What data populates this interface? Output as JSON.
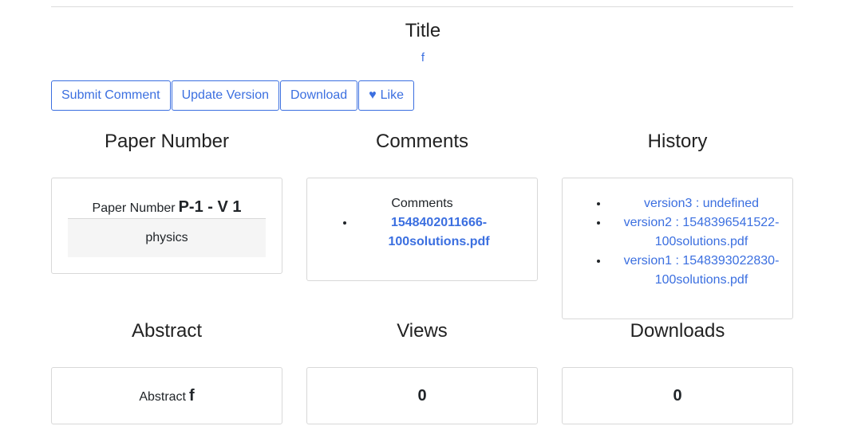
{
  "header": {
    "title": "Title",
    "subtitle_link": "f"
  },
  "toolbar": {
    "submit_comment": "Submit Comment",
    "update_version": "Update Version",
    "download": "Download",
    "like": "Like"
  },
  "paper_number": {
    "heading": "Paper Number",
    "label": "Paper Number",
    "value": "P-1 - V 1",
    "category": "physics"
  },
  "comments": {
    "heading": "Comments",
    "label": "Comments",
    "items": [
      {
        "line1": "1548402011666-",
        "line2": "100solutions.pdf"
      }
    ]
  },
  "history": {
    "heading": "History",
    "items": [
      {
        "line1": "version3 : undefined",
        "line2": ""
      },
      {
        "line1": "version2 : 1548396541522-",
        "line2": "100solutions.pdf"
      },
      {
        "line1": "version1 : 1548393022830-",
        "line2": "100solutions.pdf"
      }
    ]
  },
  "abstract": {
    "heading": "Abstract",
    "label": "Abstract",
    "value": "f"
  },
  "views": {
    "heading": "Views",
    "count": "0"
  },
  "downloads": {
    "heading": "Downloads",
    "count": "0"
  },
  "colors": {
    "accent": "#3b6fe0",
    "border": "#d8d8d8",
    "field_bg": "#f5f5f5"
  },
  "icons": {
    "like": "heart-icon"
  }
}
